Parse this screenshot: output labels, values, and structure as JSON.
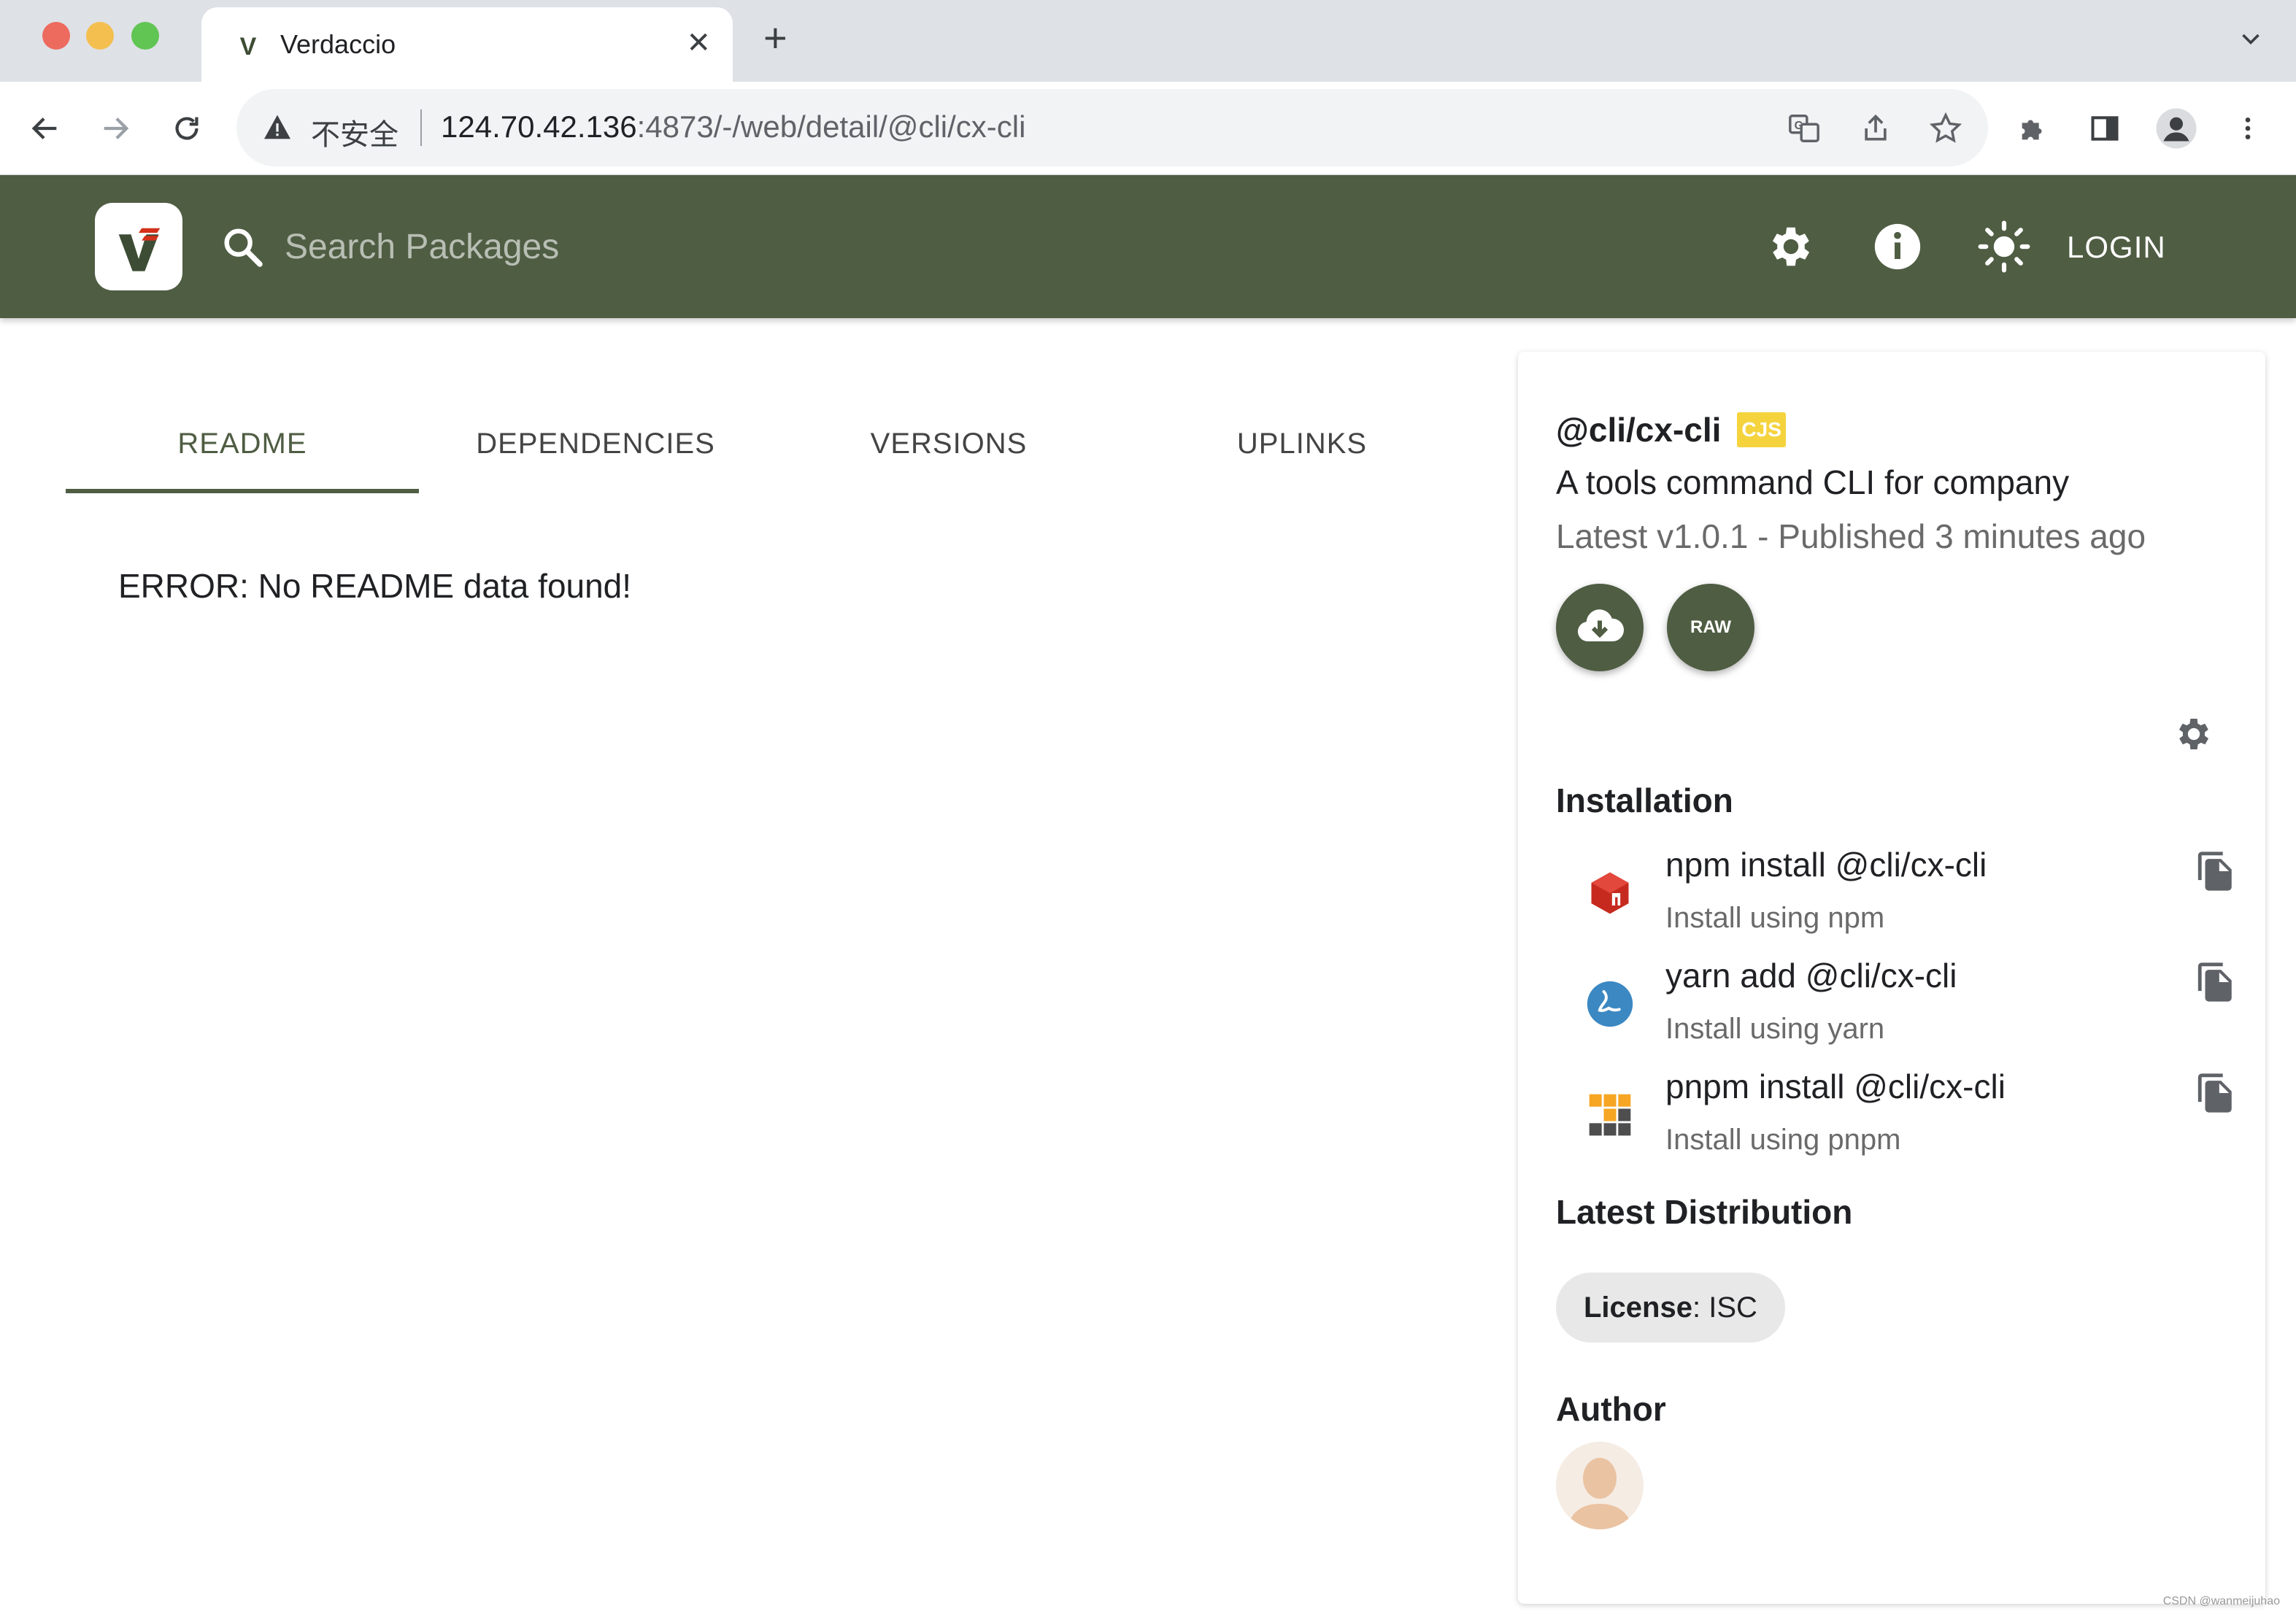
{
  "browser": {
    "tab_title": "Verdaccio",
    "tab_favicon_letter": "V",
    "security_label": "不安全",
    "url_host": "124.70.42.136",
    "url_path": ":4873/-/web/detail/@cli/cx-cli"
  },
  "header": {
    "logo_letter": "V",
    "search_placeholder": "Search Packages",
    "login_label": "LOGIN",
    "color_primary": "#4f5d43"
  },
  "tabs": [
    {
      "label": "README",
      "active": true
    },
    {
      "label": "DEPENDENCIES",
      "active": false
    },
    {
      "label": "VERSIONS",
      "active": false
    },
    {
      "label": "UPLINKS",
      "active": false
    }
  ],
  "readme": {
    "error_text": "ERROR: No README data found!"
  },
  "package": {
    "name": "@cli/cx-cli",
    "module_badge": "CJS",
    "description": "A tools command CLI for company",
    "latest_text": "Latest v1.0.1 - Published 3 minutes ago",
    "raw_label": "RAW"
  },
  "installation": {
    "title": "Installation",
    "items": [
      {
        "command": "npm install @cli/cx-cli",
        "subtitle": "Install using npm",
        "icon": "npm-icon"
      },
      {
        "command": "yarn add @cli/cx-cli",
        "subtitle": "Install using yarn",
        "icon": "yarn-icon"
      },
      {
        "command": "pnpm install @cli/cx-cli",
        "subtitle": "Install using pnpm",
        "icon": "pnpm-icon"
      }
    ]
  },
  "distribution": {
    "title": "Latest Distribution",
    "license_label": "License",
    "license_value": "ISC"
  },
  "author": {
    "title": "Author"
  },
  "watermark": "CSDN @wanmeijuhao"
}
